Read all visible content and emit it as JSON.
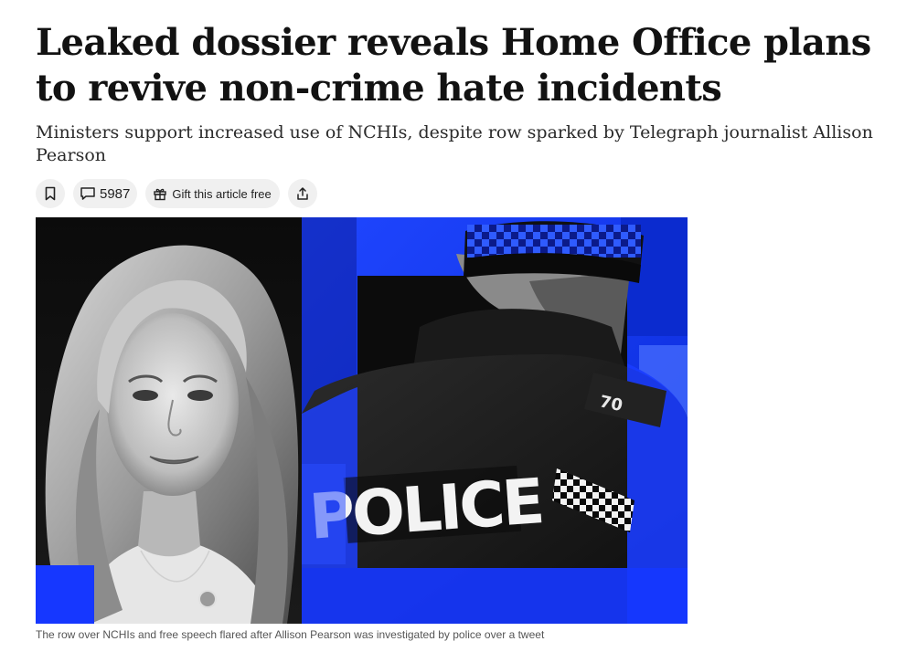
{
  "article": {
    "headline": "Leaked dossier reveals Home Office plans to revive non-crime hate incidents",
    "subheadline": "Ministers support increased use of NCHIs, despite row sparked by Telegraph journalist Allison Pearson",
    "actions": {
      "bookmark_icon": "bookmark-icon",
      "comment_icon": "comment-icon",
      "comment_count": "5987",
      "gift_icon": "gift-icon",
      "gift_label": "Gift this article free",
      "share_icon": "share-icon"
    },
    "image": {
      "description_text": "POLICE",
      "shoulder_number": "70",
      "accent_color": "#1a3cff"
    },
    "caption": "The row over NCHIs and free speech flared after Allison Pearson was investigated by police over a tweet"
  }
}
